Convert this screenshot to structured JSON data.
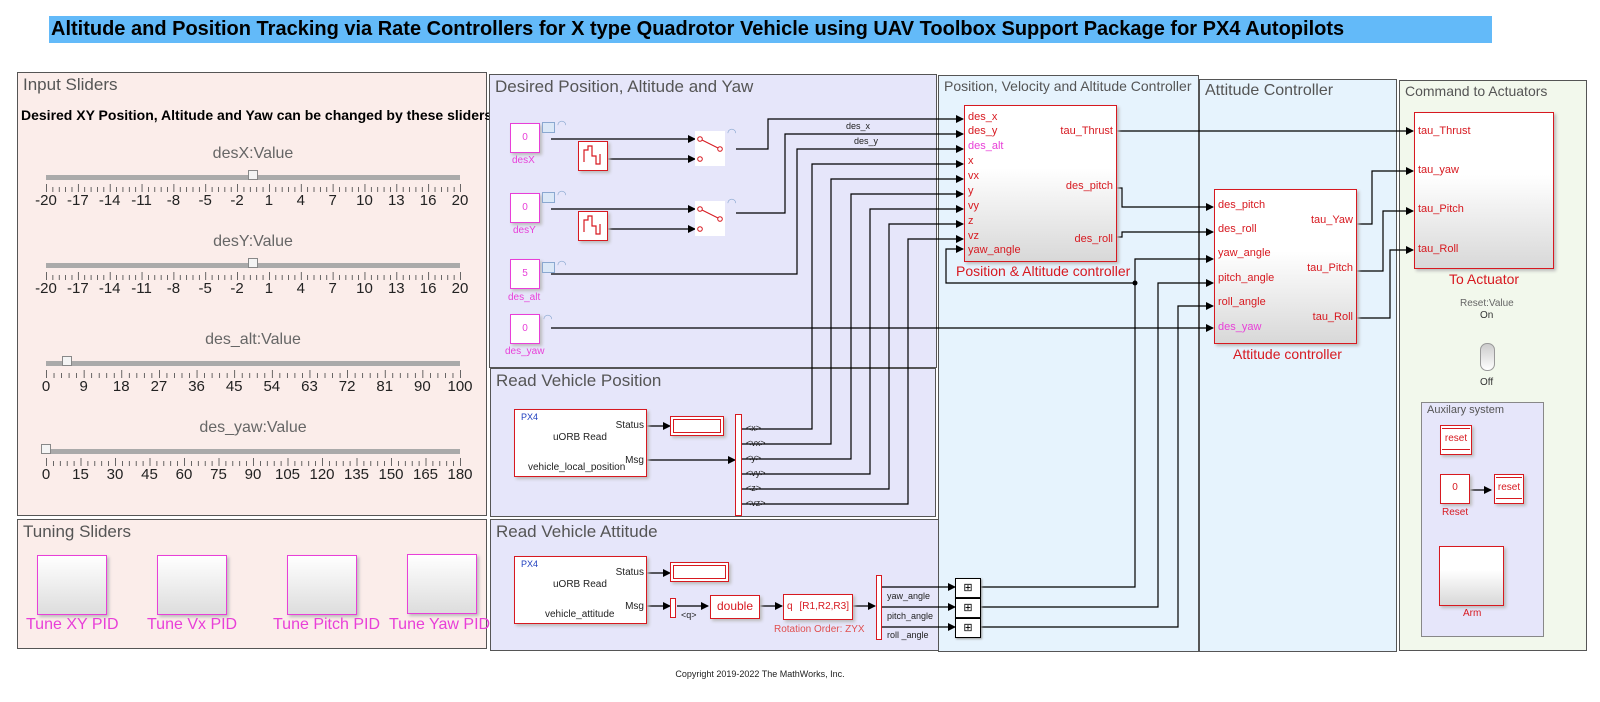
{
  "title": "Altitude and Position Tracking via Rate Controllers for X type Quadrotor Vehicle using UAV Toolbox Support Package for PX4 Autopilots",
  "colors": {
    "title_banner": "#63baf9",
    "block_red": "#d71920",
    "block_magenta": "#e83fd8",
    "area_pink": "#fbedea",
    "area_lavender": "#e6e6fa",
    "area_blue": "#e6f3fd",
    "area_green": "#f2f8ec"
  },
  "input_sliders": {
    "title": "Input Sliders",
    "description": "Desired XY Position, Altitude and Yaw can be changed by these sliders",
    "sliders": [
      {
        "label": "desX:Value",
        "min": -20,
        "max": 20,
        "value": 0,
        "tick_labels": [
          "-20",
          "-17",
          "-14",
          "-11",
          "-8",
          "-5",
          "-2",
          "1",
          "4",
          "7",
          "10",
          "13",
          "16",
          "20"
        ]
      },
      {
        "label": "desY:Value",
        "min": -20,
        "max": 20,
        "value": 0,
        "tick_labels": [
          "-20",
          "-17",
          "-14",
          "-11",
          "-8",
          "-5",
          "-2",
          "1",
          "4",
          "7",
          "10",
          "13",
          "16",
          "20"
        ]
      },
      {
        "label": "des_alt:Value",
        "min": 0,
        "max": 100,
        "value": 5,
        "tick_labels": [
          "0",
          "9",
          "18",
          "27",
          "36",
          "45",
          "54",
          "63",
          "72",
          "81",
          "90",
          "100"
        ]
      },
      {
        "label": "des_yaw:Value",
        "min": 0,
        "max": 180,
        "value": 0,
        "tick_labels": [
          "0",
          "15",
          "30",
          "45",
          "60",
          "75",
          "90",
          "105",
          "120",
          "135",
          "150",
          "165",
          "180"
        ]
      }
    ]
  },
  "tuning_sliders": {
    "title": "Tuning Sliders",
    "blocks": [
      "Tune XY PID",
      "Tune Vx PID",
      "Tune Pitch PID",
      "Tune Yaw PID"
    ]
  },
  "desired_area": {
    "title": "Desired Position, Altitude and Yaw",
    "constants": [
      {
        "name": "desX",
        "value": "0"
      },
      {
        "name": "desY",
        "value": "0"
      },
      {
        "name": "des_alt",
        "value": "5"
      },
      {
        "name": "des_yaw",
        "value": "0"
      }
    ],
    "signal_labels": [
      "des_x",
      "des_y"
    ]
  },
  "read_position": {
    "title": "Read Vehicle Position",
    "block": {
      "tag": "PX4",
      "name": "uORB Read",
      "topic": "vehicle_local_position",
      "ports": [
        "Status",
        "Msg"
      ]
    },
    "bus_signals": [
      "<x>",
      "<vx>",
      "<y>",
      "<vy>",
      "<z>",
      "<vz>"
    ]
  },
  "read_attitude": {
    "title": "Read Vehicle Attitude",
    "block": {
      "tag": "PX4",
      "name": "uORB Read",
      "topic": "vehicle_attitude",
      "ports": [
        "Status",
        "Msg"
      ]
    },
    "q_label": "<q>",
    "convert_label": "double",
    "quat_block": {
      "input": "q",
      "output": "[R1,R2,R3]",
      "caption": "Rotation Order: ZYX"
    },
    "outputs": [
      "yaw_angle",
      "pitch_angle",
      "roll _angle"
    ]
  },
  "pos_controller_area": {
    "title": "Position, Velocity and Altitude Controller",
    "block_name": "Position & Altitude controller",
    "inputs": [
      "des_x",
      "des_y",
      "des_alt",
      "x",
      "vx",
      "y",
      "vy",
      "z",
      "vz",
      "yaw_angle"
    ],
    "outputs": [
      "tau_Thrust",
      "des_pitch",
      "des_roll"
    ]
  },
  "attitude_area": {
    "title": "Attitude Controller",
    "block_name": "Attitude controller",
    "inputs": [
      "des_pitch",
      "des_roll",
      "yaw_angle",
      "pitch_angle",
      "roll_angle",
      "des_yaw"
    ],
    "outputs": [
      "tau_Yaw",
      "tau_Pitch",
      "tau_Roll"
    ]
  },
  "actuators_area": {
    "title": "Command to Actuators",
    "block_name": "To Actuator",
    "inputs": [
      "tau_Thrust",
      "tau_yaw",
      "tau_Pitch",
      "tau_Roll"
    ],
    "switch": {
      "label": "Reset:Value",
      "on_label": "On",
      "off_label": "Off",
      "state": "Off"
    },
    "aux": {
      "title": "Auxilary system",
      "reset_from": "reset",
      "reset_const": "0",
      "reset_const_name": "Reset",
      "reset_goto": "reset",
      "arm_name": "Arm"
    }
  },
  "copyright": "Copyright 2019-2022 The MathWorks, Inc."
}
